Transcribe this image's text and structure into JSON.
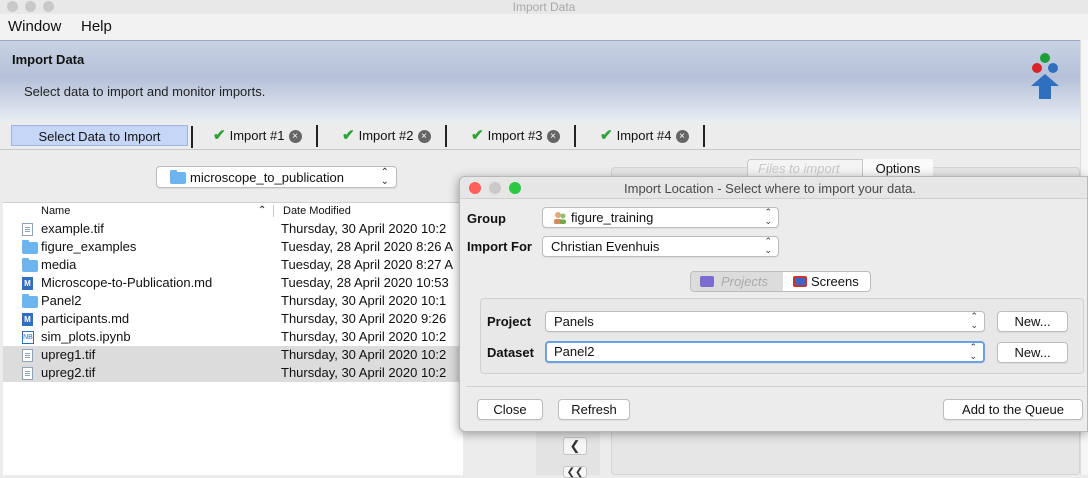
{
  "window": {
    "title": "Import Data"
  },
  "menu": {
    "items": [
      "Window",
      "Help"
    ]
  },
  "banner": {
    "title": "Import Data",
    "subtitle": "Select data to import and monitor imports."
  },
  "tabs": [
    {
      "label": "Select Data to Import"
    },
    {
      "label": "Import #1"
    },
    {
      "label": "Import #2"
    },
    {
      "label": "Import #3"
    },
    {
      "label": "Import #4"
    }
  ],
  "folder": {
    "selected": "microscope_to_publication"
  },
  "files": {
    "columns": {
      "name": "Name",
      "date": "Date Modified"
    },
    "rows": [
      {
        "name": "example.tif",
        "date": "Thursday, 30 April 2020 10:2",
        "icon": "file-icon",
        "selected": false
      },
      {
        "name": "figure_examples",
        "date": "Tuesday, 28 April 2020 8:26 A",
        "icon": "folder-icon",
        "selected": false
      },
      {
        "name": "media",
        "date": "Tuesday, 28 April 2020 8:27 A",
        "icon": "folder-icon",
        "selected": false
      },
      {
        "name": "Microscope-to-Publication.md",
        "date": "Tuesday, 28 April 2020 10:53",
        "icon": "markdown-icon",
        "selected": false
      },
      {
        "name": "Panel2",
        "date": "Thursday, 30 April 2020 10:1",
        "icon": "folder-icon",
        "selected": false
      },
      {
        "name": "participants.md",
        "date": "Thursday, 30 April 2020 9:26",
        "icon": "markdown-icon",
        "selected": false
      },
      {
        "name": "sim_plots.ipynb",
        "date": "Thursday, 30 April 2020 10:2",
        "icon": "notebook-icon",
        "selected": false
      },
      {
        "name": "upreg1.tif",
        "date": "Thursday, 30 April 2020 10:2",
        "icon": "file-icon",
        "selected": true
      },
      {
        "name": "upreg2.tif",
        "date": "Thursday, 30 April 2020 10:2",
        "icon": "file-icon",
        "selected": true
      }
    ]
  },
  "right_panel": {
    "files_tab": "Files to import",
    "options_tab": "Options"
  },
  "dialog": {
    "title": "Import Location - Select where to import your data.",
    "group_label": "Group",
    "group_value": "figure_training",
    "import_for_label": "Import For",
    "import_for_value": "Christian Evenhuis",
    "projects_tab": "Projects",
    "screens_tab": "Screens",
    "project_label": "Project",
    "project_value": "Panels",
    "dataset_label": "Dataset",
    "dataset_value": "Panel2",
    "new_label": "New...",
    "close_label": "Close",
    "refresh_label": "Refresh",
    "queue_label": "Add to the Queue"
  },
  "colors": {
    "active_tab": "#c6d6f6",
    "check": "#2ea336",
    "focus_ring": "#6aa0e6",
    "folder": "#6cb5ee"
  }
}
